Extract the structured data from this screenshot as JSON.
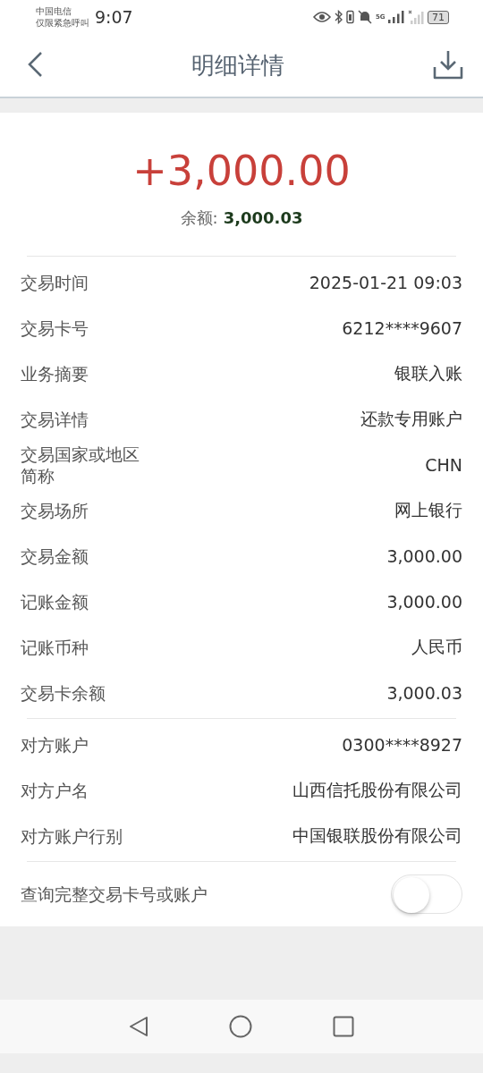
{
  "status_bar": {
    "carrier": "中国电信",
    "carrier_note": "仅限紧急呼叫",
    "time": "9:07",
    "network": "5G",
    "battery": "71"
  },
  "header": {
    "title": "明细详情"
  },
  "summary": {
    "amount": "+3,000.00",
    "balance_label": "余额:",
    "balance": "3,000.03"
  },
  "groups": [
    {
      "rows": [
        {
          "label": "交易时间",
          "value": "2025-01-21 09:03"
        },
        {
          "label": "交易卡号",
          "value": "6212****9607"
        },
        {
          "label": "业务摘要",
          "value": "银联入账"
        },
        {
          "label": "交易详情",
          "value": "还款专用账户"
        },
        {
          "label": "交易国家或地区简称",
          "value": "CHN"
        },
        {
          "label": "交易场所",
          "value": "网上银行"
        },
        {
          "label": "交易金额",
          "value": "3,000.00"
        },
        {
          "label": "记账金额",
          "value": "3,000.00"
        },
        {
          "label": "记账币种",
          "value": "人民币"
        },
        {
          "label": "交易卡余额",
          "value": "3,000.03"
        }
      ]
    },
    {
      "rows": [
        {
          "label": "对方账户",
          "value": "0300****8927"
        },
        {
          "label": "对方户名",
          "value": "山西信托股份有限公司"
        },
        {
          "label": "对方账户行别",
          "value": "中国银联股份有限公司"
        }
      ]
    }
  ],
  "toggle": {
    "label": "查询完整交易卡号或账户",
    "on": false
  }
}
